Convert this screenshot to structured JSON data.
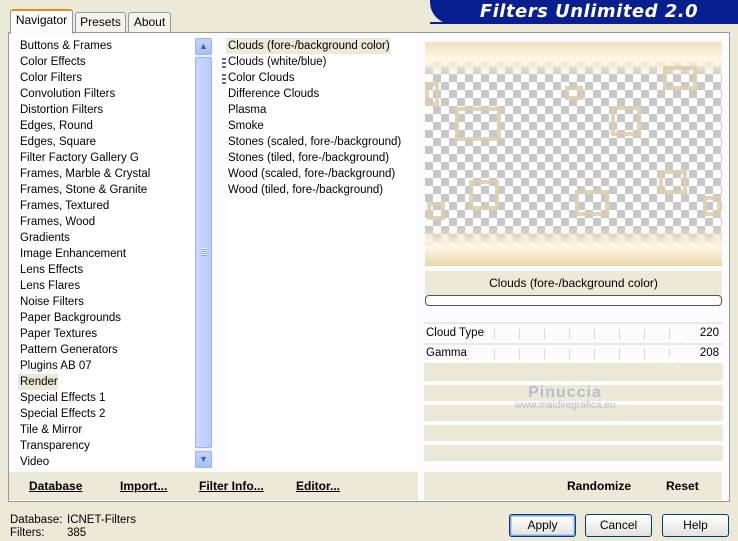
{
  "header": {
    "title": "Filters Unlimited 2.0"
  },
  "tabs": [
    {
      "label": "Navigator",
      "active": true
    },
    {
      "label": "Presets",
      "active": false
    },
    {
      "label": "About",
      "active": false
    }
  ],
  "categories": [
    "Buttons & Frames",
    "Color Effects",
    "Color Filters",
    "Convolution Filters",
    "Distortion Filters",
    "Edges, Round",
    "Edges, Square",
    "Filter Factory Gallery G",
    "Frames, Marble & Crystal",
    "Frames, Stone & Granite",
    "Frames, Textured",
    "Frames, Wood",
    "Gradients",
    "Image Enhancement",
    "Lens Effects",
    "Lens Flares",
    "Noise Filters",
    "Paper Backgrounds",
    "Paper Textures",
    "Pattern Generators",
    "Plugins AB 07",
    "Render",
    "Special Effects 1",
    "Special Effects 2",
    "Tile & Mirror",
    "Transparency",
    "Video"
  ],
  "selected_category": "Render",
  "filters": [
    "Clouds (fore-/background color)",
    "Clouds (white/blue)",
    "Color Clouds",
    "Difference Clouds",
    "Plasma",
    "Smoke",
    "Stones (scaled, fore-/background)",
    "Stones (tiled, fore-/background)",
    "Wood (scaled, fore-/background)",
    "Wood (tiled, fore-/background)"
  ],
  "selected_filter": "Clouds (fore-/background color)",
  "preview": {
    "effect_name": "Clouds (fore-/background color)"
  },
  "params": [
    {
      "label": "Cloud Type",
      "value": "220"
    },
    {
      "label": "Gamma",
      "value": "208"
    }
  ],
  "watermark": {
    "name": "Pinuccia",
    "url": "www.maidiregrafica.eu"
  },
  "toolbar": {
    "database": "Database",
    "import": "Import...",
    "filter_info": "Filter Info...",
    "editor": "Editor...",
    "randomize": "Randomize",
    "reset": "Reset"
  },
  "status": {
    "database_label": "Database:",
    "database_value": "ICNET-Filters",
    "filters_label": "Filters:",
    "filters_value": "385"
  },
  "dialog": {
    "apply": "Apply",
    "cancel": "Cancel",
    "help": "Help"
  },
  "colors": {
    "banner": "#0a1f8f",
    "selection": "#ece9d8",
    "window": "#ece9d8",
    "tab_highlight": "#e68b2c"
  }
}
